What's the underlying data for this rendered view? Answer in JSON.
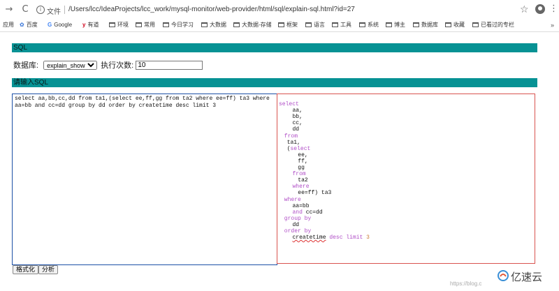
{
  "browser": {
    "back": "→",
    "reload": "C",
    "info": "i",
    "file_label": "文件",
    "address": "/Users/lcc/IdeaProjects/lcc_work/mysql-monitor/web-provider/html/sql/explain-sql.html?id=27",
    "star": "☆",
    "menu": "⋮"
  },
  "bookmarks": {
    "apps": "应用",
    "items": [
      "百度",
      "Google",
      "有道",
      "环境",
      "常用",
      "今日学习",
      "大数据",
      "大数据-存储",
      "框架",
      "语言",
      "工具",
      "系统",
      "博主",
      "数据库",
      "收藏",
      "已看过的专栏"
    ],
    "more": "»"
  },
  "page": {
    "sql_header": "SQL",
    "db_label": "数据库:",
    "db_selected": "explain_show",
    "exec_label": "执行次数:",
    "exec_value": "10",
    "input_header": "请输入SQL",
    "sql_input": "select aa,bb,cc,dd from ta1,(select ee,ff,gg from ta2 where ee=ff) ta3 where aa=bb and cc=dd group by dd order by createtime desc limit 3",
    "format_button": "格式化",
    "analyze_button": "分析"
  },
  "formatted_sql": [
    {
      "indent": 0,
      "parts": [
        {
          "t": "select",
          "k": "kw"
        }
      ]
    },
    {
      "indent": 5,
      "parts": [
        {
          "t": "aa,"
        }
      ]
    },
    {
      "indent": 5,
      "parts": [
        {
          "t": "bb,"
        }
      ]
    },
    {
      "indent": 5,
      "parts": [
        {
          "t": "cc,"
        }
      ]
    },
    {
      "indent": 5,
      "parts": [
        {
          "t": "dd"
        }
      ]
    },
    {
      "indent": 2,
      "parts": [
        {
          "t": "from",
          "k": "kw"
        }
      ]
    },
    {
      "indent": 3,
      "parts": [
        {
          "t": "ta1,"
        }
      ]
    },
    {
      "indent": 3,
      "parts": [
        {
          "t": "("
        },
        {
          "t": "select",
          "k": "kw"
        }
      ]
    },
    {
      "indent": 7,
      "parts": [
        {
          "t": "ee,"
        }
      ]
    },
    {
      "indent": 7,
      "parts": [
        {
          "t": "ff,"
        }
      ]
    },
    {
      "indent": 7,
      "parts": [
        {
          "t": "gg"
        }
      ]
    },
    {
      "indent": 5,
      "parts": [
        {
          "t": "from",
          "k": "kw"
        }
      ]
    },
    {
      "indent": 7,
      "parts": [
        {
          "t": "ta2"
        }
      ]
    },
    {
      "indent": 5,
      "parts": [
        {
          "t": "where",
          "k": "kw"
        }
      ]
    },
    {
      "indent": 7,
      "parts": [
        {
          "t": "ee=ff) ta3"
        }
      ]
    },
    {
      "indent": 2,
      "parts": [
        {
          "t": "where",
          "k": "kw"
        }
      ]
    },
    {
      "indent": 5,
      "parts": [
        {
          "t": "aa=bb"
        }
      ]
    },
    {
      "indent": 5,
      "parts": [
        {
          "t": "and",
          "k": "kw"
        },
        {
          "t": " cc=dd"
        }
      ]
    },
    {
      "indent": 2,
      "parts": [
        {
          "t": "group by",
          "k": "kw"
        }
      ]
    },
    {
      "indent": 5,
      "parts": [
        {
          "t": "dd"
        }
      ]
    },
    {
      "indent": 2,
      "parts": [
        {
          "t": "order by",
          "k": "kw"
        }
      ]
    },
    {
      "indent": 5,
      "parts": [
        {
          "t": "createtime",
          "k": "uline"
        },
        {
          "t": " desc limit ",
          "k": "kw"
        },
        {
          "t": "3",
          "k": "num"
        }
      ]
    }
  ],
  "watermark": "https://blog.c",
  "logo_text": "亿速云",
  "colors": {
    "section_bar": "#079294",
    "editor_border": "#1b4fa6",
    "result_border": "#d9534f",
    "keyword": "#b04ec7",
    "number": "#ca7e3a"
  }
}
